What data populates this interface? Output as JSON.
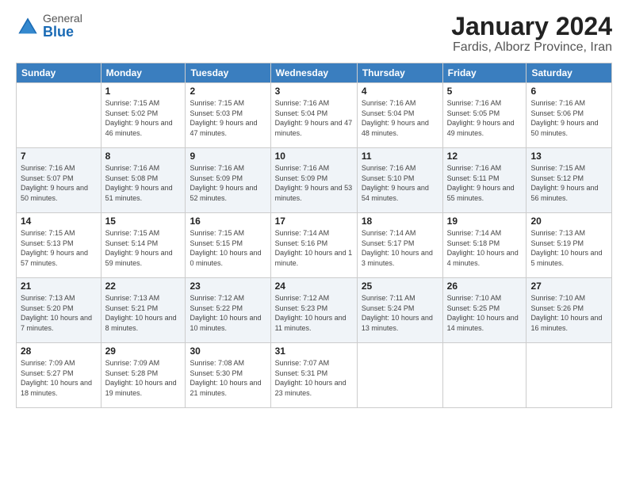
{
  "logo": {
    "general": "General",
    "blue": "Blue"
  },
  "title": "January 2024",
  "subtitle": "Fardis, Alborz Province, Iran",
  "headers": [
    "Sunday",
    "Monday",
    "Tuesday",
    "Wednesday",
    "Thursday",
    "Friday",
    "Saturday"
  ],
  "weeks": [
    [
      {
        "date": "",
        "sunrise": "",
        "sunset": "",
        "daylight": ""
      },
      {
        "date": "1",
        "sunrise": "Sunrise: 7:15 AM",
        "sunset": "Sunset: 5:02 PM",
        "daylight": "Daylight: 9 hours and 46 minutes."
      },
      {
        "date": "2",
        "sunrise": "Sunrise: 7:15 AM",
        "sunset": "Sunset: 5:03 PM",
        "daylight": "Daylight: 9 hours and 47 minutes."
      },
      {
        "date": "3",
        "sunrise": "Sunrise: 7:16 AM",
        "sunset": "Sunset: 5:04 PM",
        "daylight": "Daylight: 9 hours and 47 minutes."
      },
      {
        "date": "4",
        "sunrise": "Sunrise: 7:16 AM",
        "sunset": "Sunset: 5:04 PM",
        "daylight": "Daylight: 9 hours and 48 minutes."
      },
      {
        "date": "5",
        "sunrise": "Sunrise: 7:16 AM",
        "sunset": "Sunset: 5:05 PM",
        "daylight": "Daylight: 9 hours and 49 minutes."
      },
      {
        "date": "6",
        "sunrise": "Sunrise: 7:16 AM",
        "sunset": "Sunset: 5:06 PM",
        "daylight": "Daylight: 9 hours and 50 minutes."
      }
    ],
    [
      {
        "date": "7",
        "sunrise": "Sunrise: 7:16 AM",
        "sunset": "Sunset: 5:07 PM",
        "daylight": "Daylight: 9 hours and 50 minutes."
      },
      {
        "date": "8",
        "sunrise": "Sunrise: 7:16 AM",
        "sunset": "Sunset: 5:08 PM",
        "daylight": "Daylight: 9 hours and 51 minutes."
      },
      {
        "date": "9",
        "sunrise": "Sunrise: 7:16 AM",
        "sunset": "Sunset: 5:09 PM",
        "daylight": "Daylight: 9 hours and 52 minutes."
      },
      {
        "date": "10",
        "sunrise": "Sunrise: 7:16 AM",
        "sunset": "Sunset: 5:09 PM",
        "daylight": "Daylight: 9 hours and 53 minutes."
      },
      {
        "date": "11",
        "sunrise": "Sunrise: 7:16 AM",
        "sunset": "Sunset: 5:10 PM",
        "daylight": "Daylight: 9 hours and 54 minutes."
      },
      {
        "date": "12",
        "sunrise": "Sunrise: 7:16 AM",
        "sunset": "Sunset: 5:11 PM",
        "daylight": "Daylight: 9 hours and 55 minutes."
      },
      {
        "date": "13",
        "sunrise": "Sunrise: 7:15 AM",
        "sunset": "Sunset: 5:12 PM",
        "daylight": "Daylight: 9 hours and 56 minutes."
      }
    ],
    [
      {
        "date": "14",
        "sunrise": "Sunrise: 7:15 AM",
        "sunset": "Sunset: 5:13 PM",
        "daylight": "Daylight: 9 hours and 57 minutes."
      },
      {
        "date": "15",
        "sunrise": "Sunrise: 7:15 AM",
        "sunset": "Sunset: 5:14 PM",
        "daylight": "Daylight: 9 hours and 59 minutes."
      },
      {
        "date": "16",
        "sunrise": "Sunrise: 7:15 AM",
        "sunset": "Sunset: 5:15 PM",
        "daylight": "Daylight: 10 hours and 0 minutes."
      },
      {
        "date": "17",
        "sunrise": "Sunrise: 7:14 AM",
        "sunset": "Sunset: 5:16 PM",
        "daylight": "Daylight: 10 hours and 1 minute."
      },
      {
        "date": "18",
        "sunrise": "Sunrise: 7:14 AM",
        "sunset": "Sunset: 5:17 PM",
        "daylight": "Daylight: 10 hours and 3 minutes."
      },
      {
        "date": "19",
        "sunrise": "Sunrise: 7:14 AM",
        "sunset": "Sunset: 5:18 PM",
        "daylight": "Daylight: 10 hours and 4 minutes."
      },
      {
        "date": "20",
        "sunrise": "Sunrise: 7:13 AM",
        "sunset": "Sunset: 5:19 PM",
        "daylight": "Daylight: 10 hours and 5 minutes."
      }
    ],
    [
      {
        "date": "21",
        "sunrise": "Sunrise: 7:13 AM",
        "sunset": "Sunset: 5:20 PM",
        "daylight": "Daylight: 10 hours and 7 minutes."
      },
      {
        "date": "22",
        "sunrise": "Sunrise: 7:13 AM",
        "sunset": "Sunset: 5:21 PM",
        "daylight": "Daylight: 10 hours and 8 minutes."
      },
      {
        "date": "23",
        "sunrise": "Sunrise: 7:12 AM",
        "sunset": "Sunset: 5:22 PM",
        "daylight": "Daylight: 10 hours and 10 minutes."
      },
      {
        "date": "24",
        "sunrise": "Sunrise: 7:12 AM",
        "sunset": "Sunset: 5:23 PM",
        "daylight": "Daylight: 10 hours and 11 minutes."
      },
      {
        "date": "25",
        "sunrise": "Sunrise: 7:11 AM",
        "sunset": "Sunset: 5:24 PM",
        "daylight": "Daylight: 10 hours and 13 minutes."
      },
      {
        "date": "26",
        "sunrise": "Sunrise: 7:10 AM",
        "sunset": "Sunset: 5:25 PM",
        "daylight": "Daylight: 10 hours and 14 minutes."
      },
      {
        "date": "27",
        "sunrise": "Sunrise: 7:10 AM",
        "sunset": "Sunset: 5:26 PM",
        "daylight": "Daylight: 10 hours and 16 minutes."
      }
    ],
    [
      {
        "date": "28",
        "sunrise": "Sunrise: 7:09 AM",
        "sunset": "Sunset: 5:27 PM",
        "daylight": "Daylight: 10 hours and 18 minutes."
      },
      {
        "date": "29",
        "sunrise": "Sunrise: 7:09 AM",
        "sunset": "Sunset: 5:28 PM",
        "daylight": "Daylight: 10 hours and 19 minutes."
      },
      {
        "date": "30",
        "sunrise": "Sunrise: 7:08 AM",
        "sunset": "Sunset: 5:30 PM",
        "daylight": "Daylight: 10 hours and 21 minutes."
      },
      {
        "date": "31",
        "sunrise": "Sunrise: 7:07 AM",
        "sunset": "Sunset: 5:31 PM",
        "daylight": "Daylight: 10 hours and 23 minutes."
      },
      {
        "date": "",
        "sunrise": "",
        "sunset": "",
        "daylight": ""
      },
      {
        "date": "",
        "sunrise": "",
        "sunset": "",
        "daylight": ""
      },
      {
        "date": "",
        "sunrise": "",
        "sunset": "",
        "daylight": ""
      }
    ]
  ]
}
